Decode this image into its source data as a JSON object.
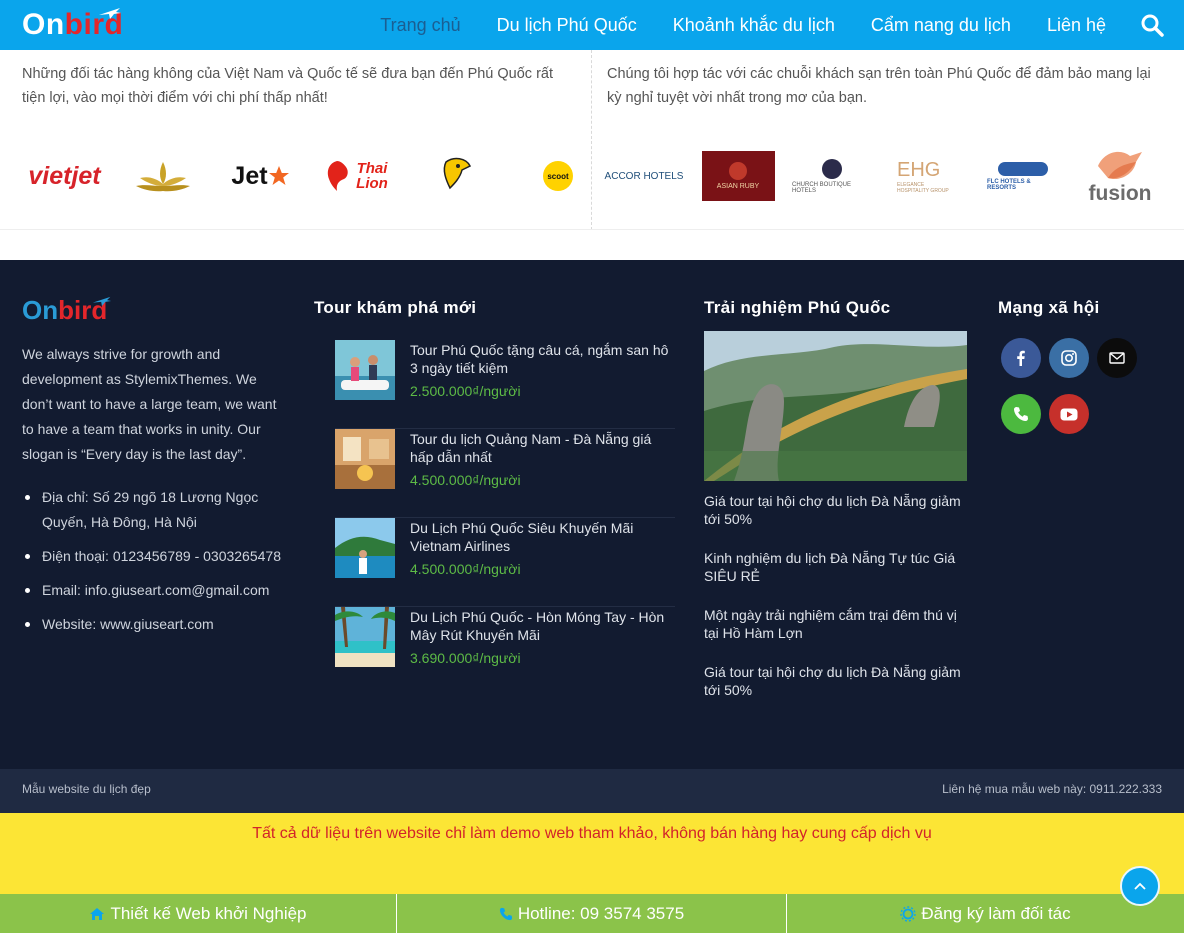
{
  "header": {
    "logo": {
      "part1": "On",
      "part2": "bird"
    },
    "nav": [
      {
        "label": "Trang chủ",
        "active": true
      },
      {
        "label": "Du lịch Phú Quốc"
      },
      {
        "label": "Khoảnh khắc du lịch"
      },
      {
        "label": "Cẩm nang du lịch"
      },
      {
        "label": "Liên hệ"
      }
    ]
  },
  "partners": {
    "airlines_text": "Những đối tác hàng không của Việt Nam và Quốc tế sẽ đưa bạn đến Phú Quốc rất tiện lợi, vào mọi thời điểm với chi phí thấp nhất!",
    "hotels_text": "Chúng tôi hợp tác với các chuỗi khách sạn trên toàn Phú Quốc để đảm bảo mang lại kỳ nghỉ tuyệt vời nhất trong mơ của bạn.",
    "airline_logos": [
      "vietjet",
      "",
      "Jet",
      "Thai Lion",
      "nok",
      "scoot"
    ],
    "hotel_logos": [
      "ACCOR HOTELS",
      "ASIAN RUBY",
      "CHURCH BOUTIQUE HOTELS",
      "EHG",
      "FLC HOTELS & RESORTS",
      "fusion"
    ]
  },
  "footer": {
    "logo": {
      "part1": "On",
      "part2": "bird"
    },
    "description": "We always strive for growth and development as StylemixThemes. We don’t want to have a large team, we want to have a team that works in unity. Our slogan is “Every day is the last day”.",
    "contacts": [
      "Địa chỉ: Số 29 ngõ 18 Lương Ngọc Quyến, Hà Đông, Hà Nội",
      "Điện thoại: 0123456789 - 0303265478",
      "Email: info.giuseart.com@gmail.com",
      "Website: www.giuseart.com"
    ],
    "tours_title": "Tour khám phá mới",
    "tours": [
      {
        "name": "Tour Phú Quốc tặng câu cá, ngắm san hô 3 ngày tiết kiệm",
        "price": "2.500.000₫/người"
      },
      {
        "name": "Tour du lịch Quảng Nam - Đà Nẵng giá hấp dẫn nhất",
        "price": "4.500.000₫/người"
      },
      {
        "name": "Du Lịch Phú Quốc Siêu Khuyến Mãi Vietnam Airlines",
        "price": "4.500.000₫/người"
      },
      {
        "name": "Du Lịch Phú Quốc - Hòn Móng Tay - Hòn Mây Rút Khuyến Mãi",
        "price": "3.690.000₫/người"
      }
    ],
    "experience_title": "Trải nghiệm Phú Quốc",
    "experience_links": [
      "Giá tour tại hội chợ du lịch Đà Nẵng giảm tới 50%",
      "Kinh nghiệm du lịch Đà Nẵng Tự túc Giá SIÊU RẺ",
      "Một ngày trải nghiệm cắm trại đêm thú vị tại Hồ Hàm Lợn",
      "Giá tour tại hội chợ du lịch Đà Nẵng giảm tới 50%"
    ],
    "social_title": "Mạng xã hội",
    "social": [
      "facebook-icon",
      "instagram-icon",
      "email-icon",
      "phone-icon",
      "youtube-icon"
    ]
  },
  "bottom_bar": {
    "left": "Mẫu website du lịch đẹp",
    "right": "Liên hệ mua mẫu web này: 0911.222.333"
  },
  "notice": "Tất cả dữ liệu trên website chỉ làm demo web tham khảo, không bán hàng hay cung cấp dịch vụ",
  "cta": [
    {
      "label": "Thiết kế Web khởi Nghiệp",
      "icon": "home-icon"
    },
    {
      "label": "Hotline: 09 3574 3575",
      "icon": "phone-icon"
    },
    {
      "label": "Đăng ký làm đối tác",
      "icon": "sun-icon"
    }
  ],
  "colors": {
    "header": "#0aa5ec",
    "footer": "#121b30",
    "price": "#5dbb46",
    "notice_bg": "#fce535",
    "notice_text": "#d2232a",
    "cta": "#8bc34a"
  }
}
